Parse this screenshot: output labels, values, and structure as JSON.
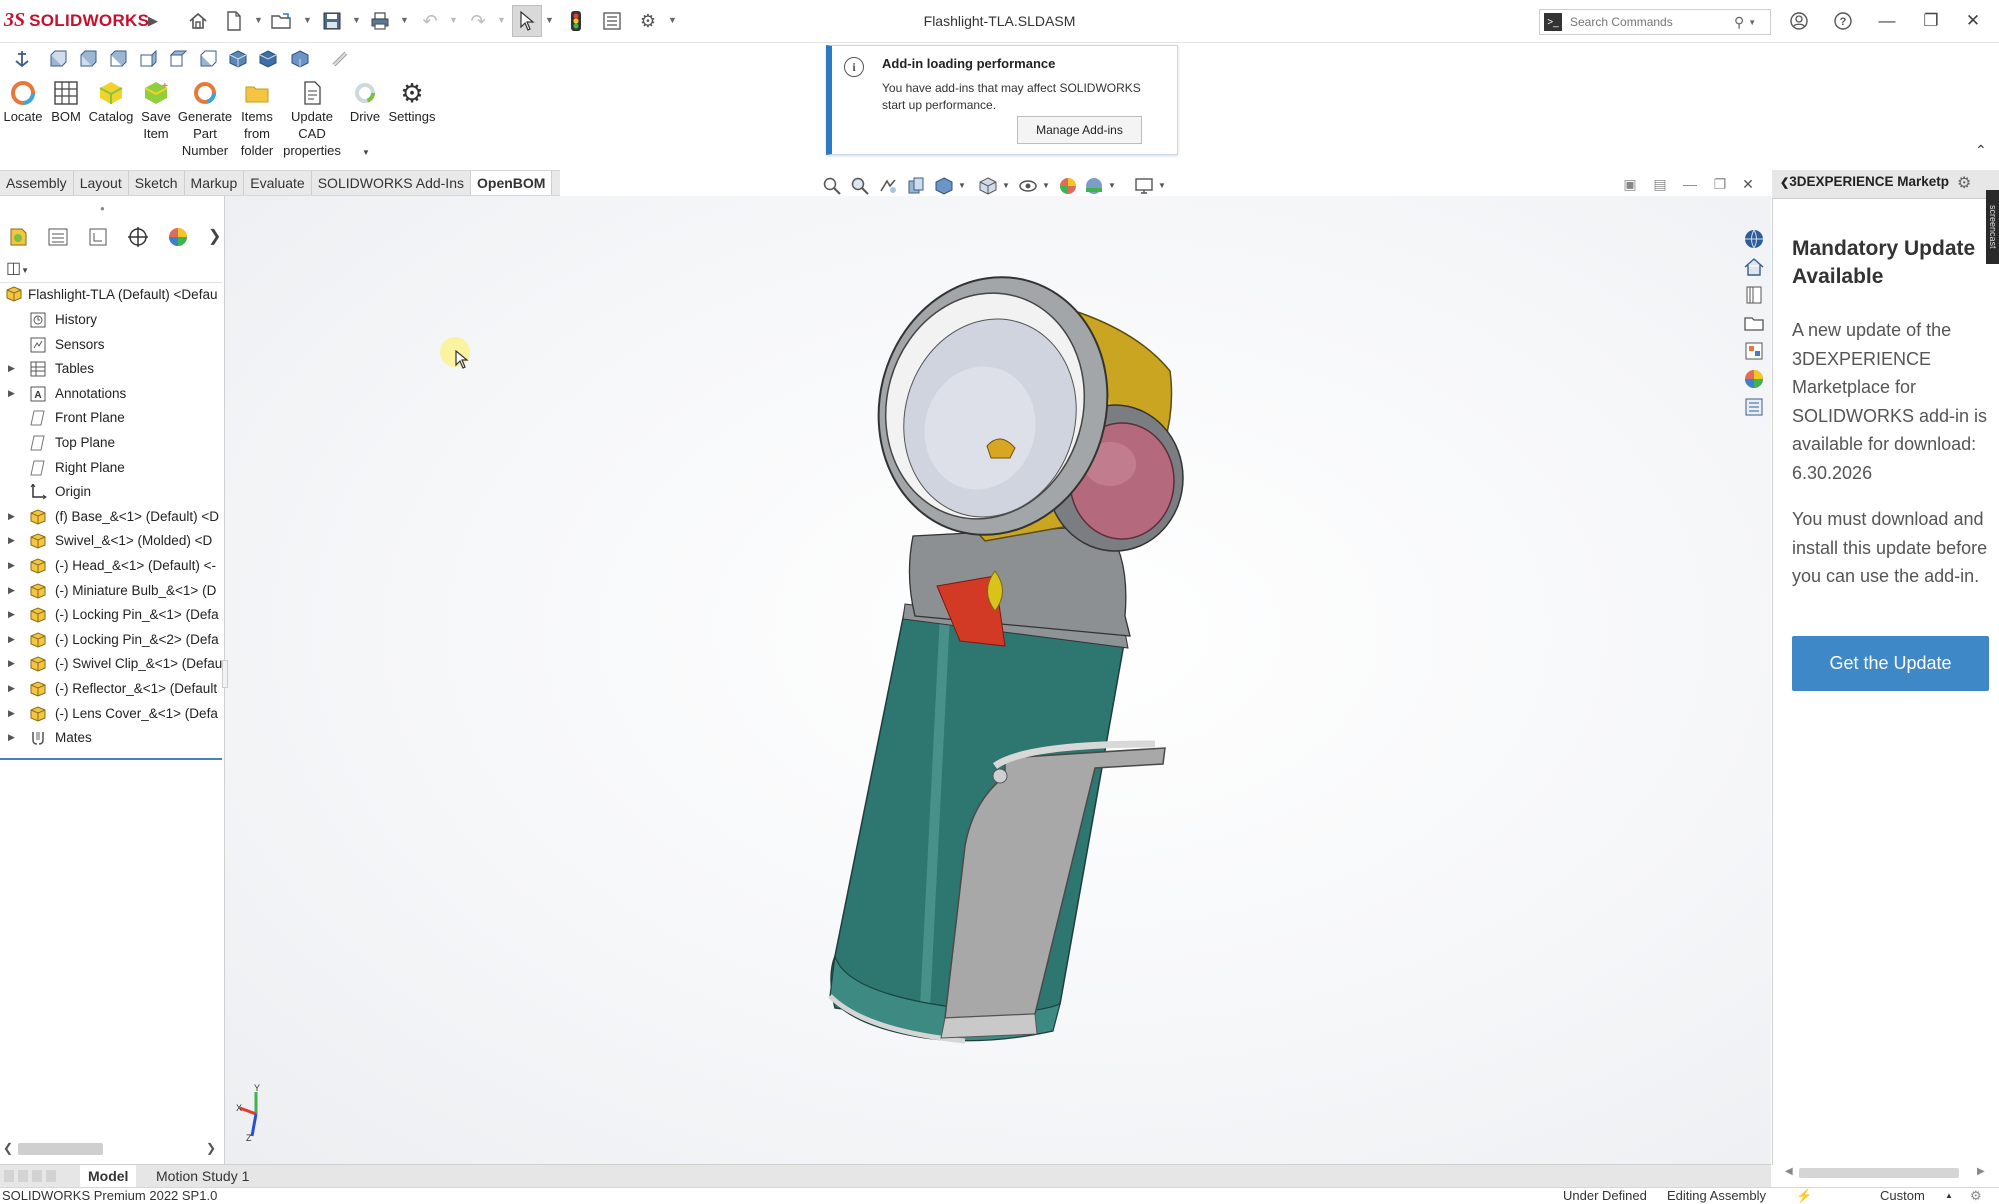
{
  "app": {
    "brand_prefix": "3S",
    "brand_name": "SOLIDWORKS",
    "document_title": "Flashlight-TLA.SLDASM"
  },
  "search": {
    "placeholder": "Search Commands"
  },
  "commands": [
    {
      "id": "locate",
      "label": "Locate"
    },
    {
      "id": "bom",
      "label": "BOM"
    },
    {
      "id": "catalog",
      "label": "Catalog"
    },
    {
      "id": "save-item",
      "label": "Save\nItem"
    },
    {
      "id": "generate-part-number",
      "label": "Generate\nPart\nNumber"
    },
    {
      "id": "items-from-folder",
      "label": "Items\nfrom\nfolder"
    },
    {
      "id": "update-cad-properties",
      "label": "Update\nCAD\nproperties"
    },
    {
      "id": "drive",
      "label": "Drive"
    },
    {
      "id": "settings",
      "label": "Settings"
    }
  ],
  "notification": {
    "title": "Add-in loading performance",
    "body": "You have add-ins that may affect SOLIDWORKS start up performance.",
    "button": "Manage Add-ins"
  },
  "tabs": [
    "Assembly",
    "Layout",
    "Sketch",
    "Markup",
    "Evaluate",
    "SOLIDWORKS Add-Ins",
    "OpenBOM"
  ],
  "active_tab": "OpenBOM",
  "tree": {
    "root": "Flashlight-TLA (Default) <Defau",
    "items": [
      {
        "label": "History",
        "icon": "history-icon",
        "expandable": false
      },
      {
        "label": "Sensors",
        "icon": "sensor-icon",
        "expandable": false
      },
      {
        "label": "Tables",
        "icon": "table-icon",
        "expandable": true
      },
      {
        "label": "Annotations",
        "icon": "annotation-icon",
        "expandable": true
      },
      {
        "label": "Front Plane",
        "icon": "plane-icon",
        "expandable": false
      },
      {
        "label": "Top Plane",
        "icon": "plane-icon",
        "expandable": false
      },
      {
        "label": "Right Plane",
        "icon": "plane-icon",
        "expandable": false
      },
      {
        "label": "Origin",
        "icon": "origin-icon",
        "expandable": false
      },
      {
        "label": "(f) Base_&<1> (Default) <D",
        "icon": "part-icon",
        "expandable": true
      },
      {
        "label": "Swivel_&<1> (Molded) <D",
        "icon": "part-icon",
        "expandable": true
      },
      {
        "label": "(-) Head_&<1> (Default) <-",
        "icon": "part-icon",
        "expandable": true
      },
      {
        "label": "(-) Miniature Bulb_&<1> (D",
        "icon": "part-icon",
        "expandable": true
      },
      {
        "label": "(-) Locking Pin_&<1> (Defa",
        "icon": "part-icon",
        "expandable": true
      },
      {
        "label": "(-) Locking Pin_&<2> (Defa",
        "icon": "part-icon",
        "expandable": true
      },
      {
        "label": "(-) Swivel Clip_&<1> (Defau",
        "icon": "part-icon",
        "expandable": true
      },
      {
        "label": "(-) Reflector_&<1> (Default",
        "icon": "part-icon",
        "expandable": true
      },
      {
        "label": "(-) Lens Cover_&<1> (Defa",
        "icon": "part-icon",
        "expandable": true
      },
      {
        "label": "Mates",
        "icon": "mates-icon",
        "expandable": true
      }
    ]
  },
  "taskpane": {
    "header": "3DEXPERIENCE Marketp",
    "title": "Mandatory Update Available",
    "paragraph1": "A new update of the 3DEXPERIENCE Marketplace for SOLIDWORKS add-in is available for download: 6.30.2026",
    "paragraph2": "You must download and install this update before you can use the add-in.",
    "button": "Get the Update",
    "side_label": "screencast"
  },
  "bottom_tabs": [
    "Model",
    "Motion Study 1"
  ],
  "status": {
    "product": "SOLIDWORKS Premium 2022 SP1.0",
    "state": "Under Defined",
    "mode": "Editing Assembly",
    "units": "Custom"
  },
  "colors": {
    "brand_red": "#c8102e",
    "accent_blue": "#3e88c8",
    "notif_blue": "#2b79c2",
    "body_teal": "#2e7670",
    "head_yellow": "#c9a521",
    "lens_pink": "#b46a7c"
  }
}
